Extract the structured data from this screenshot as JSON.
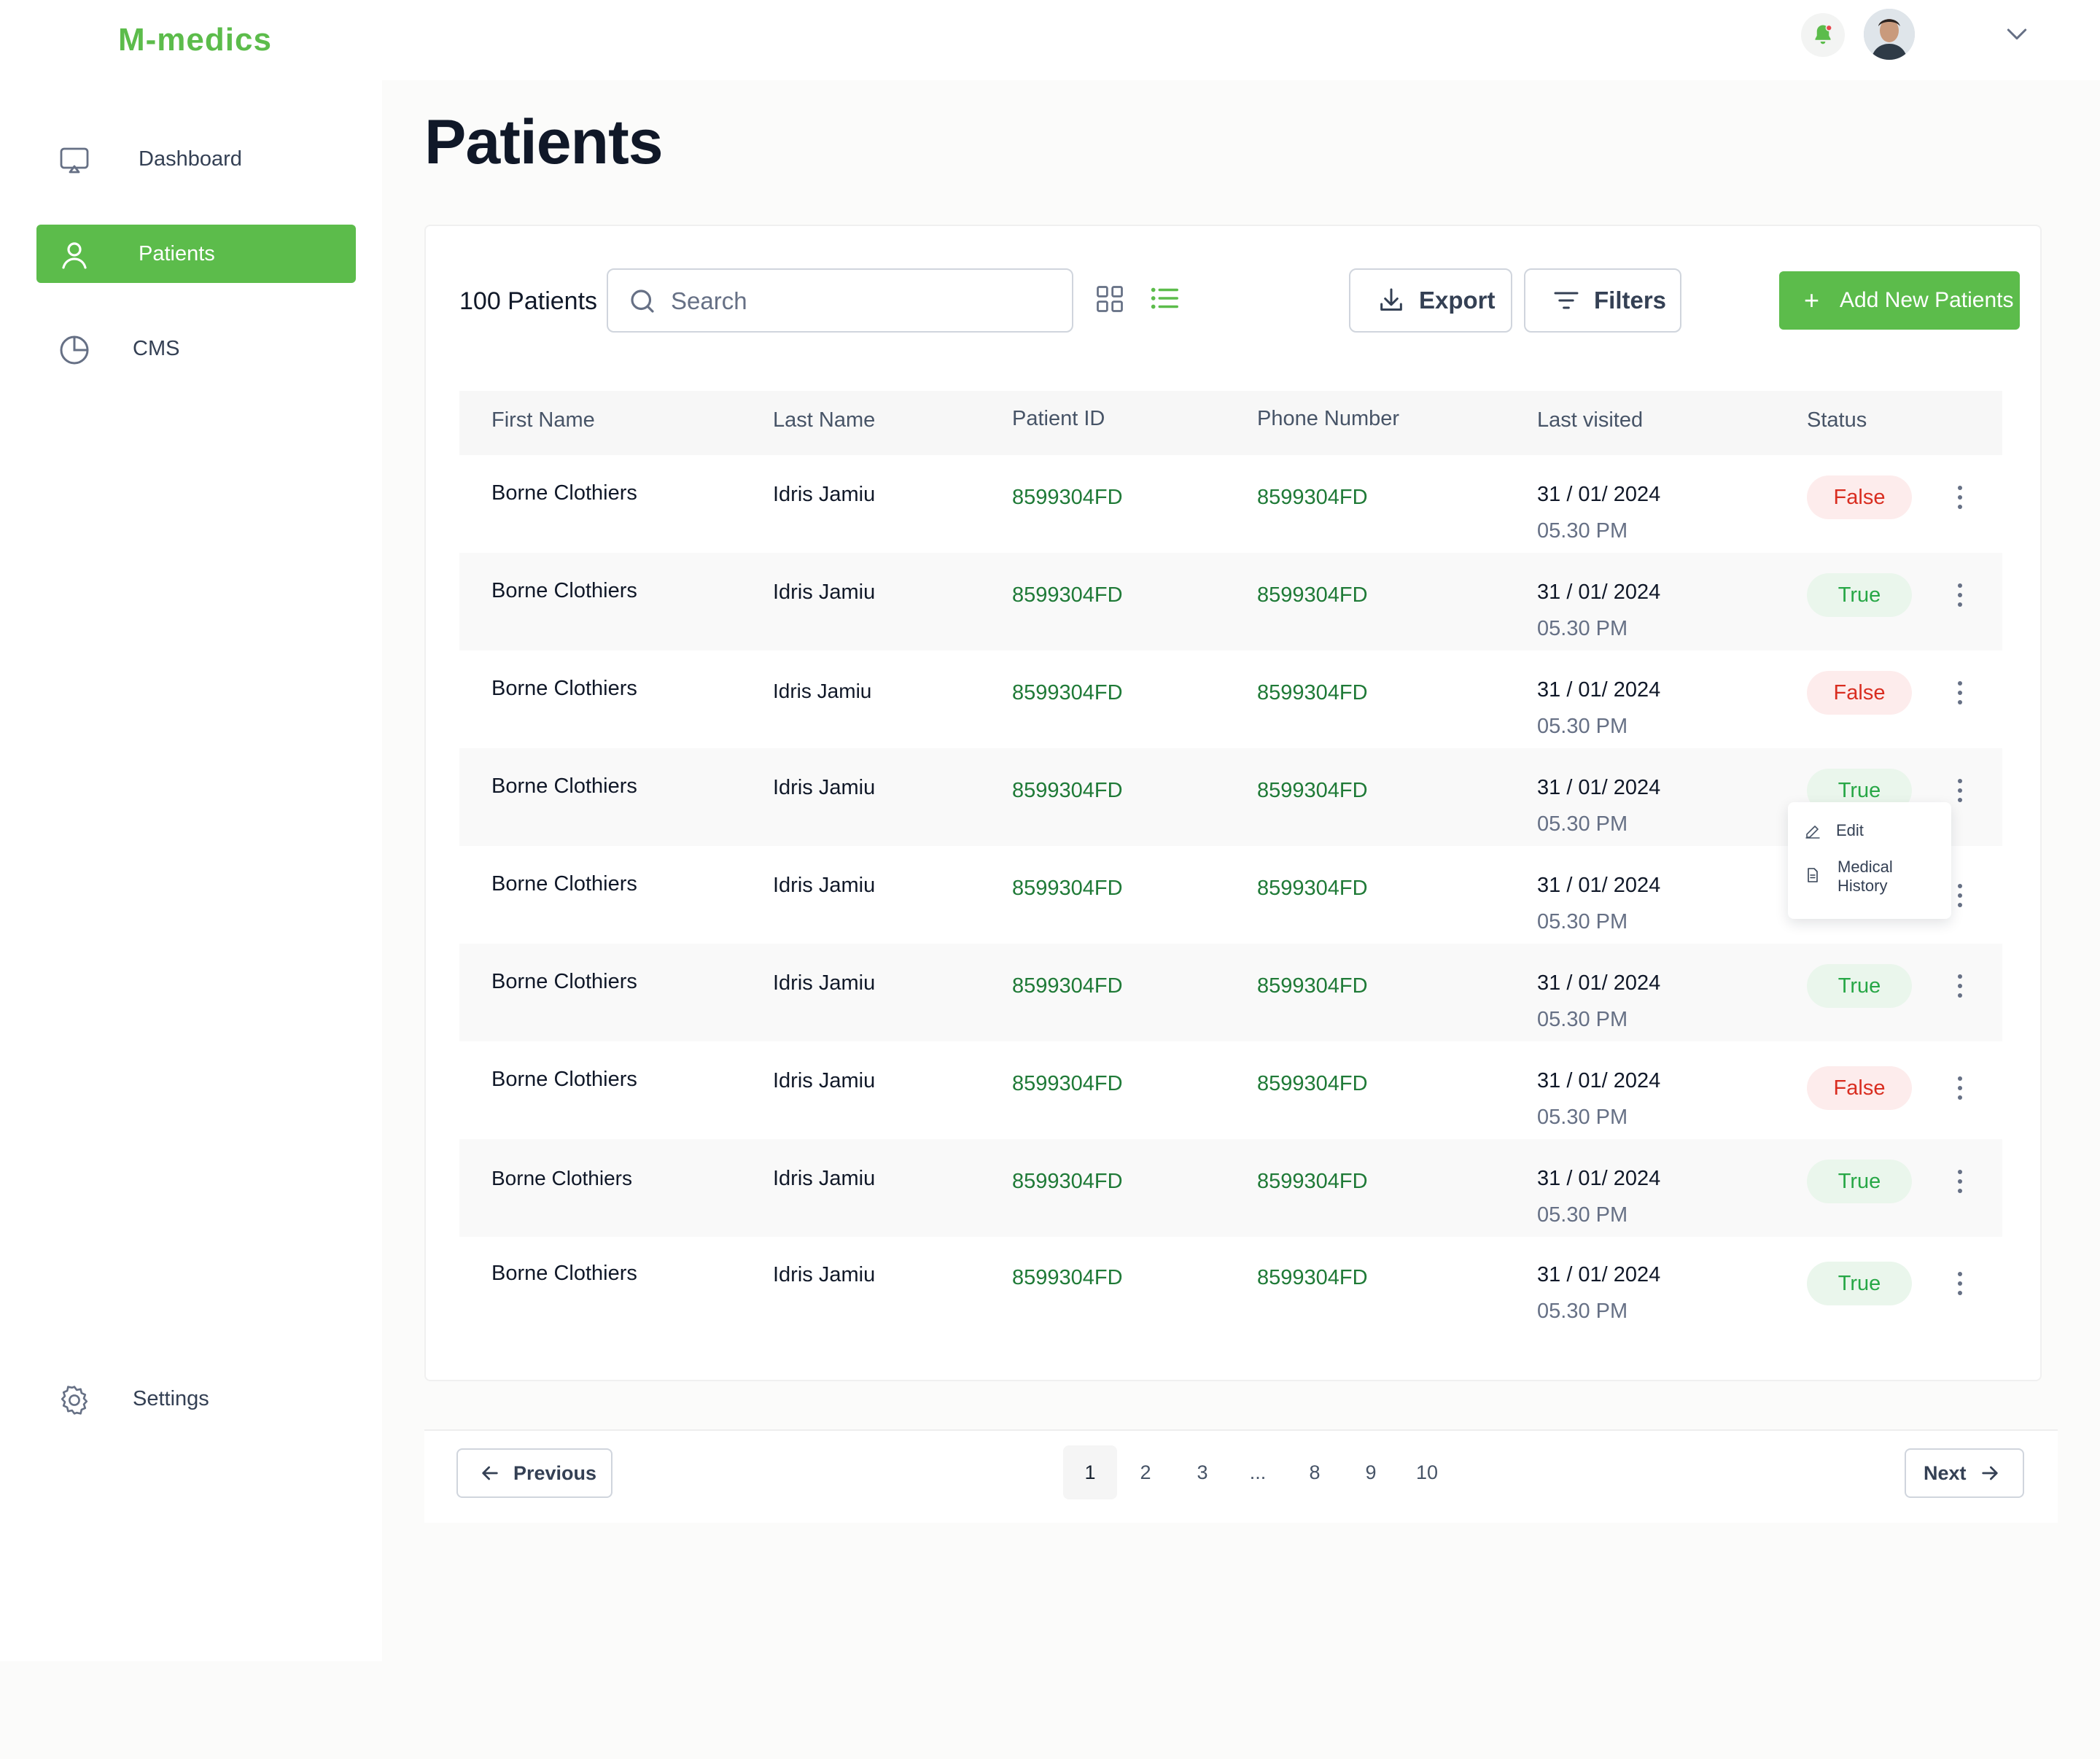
{
  "app": {
    "logo": "M-medics"
  },
  "header": {
    "bell_icon": "bell-icon",
    "has_notification": true,
    "avatar": "user-avatar"
  },
  "sidebar": {
    "items": [
      {
        "label": "Dashboard",
        "icon": "monitor-icon",
        "active": false
      },
      {
        "label": "Patients",
        "icon": "user-icon",
        "active": true
      },
      {
        "label": "CMS",
        "icon": "pie-chart-icon",
        "active": false
      }
    ],
    "settings": {
      "label": "Settings",
      "icon": "gear-icon"
    }
  },
  "page": {
    "title": "Patients"
  },
  "toolbar": {
    "count": "100 Patients",
    "search_placeholder": "Search",
    "export_label": "Export",
    "filters_label": "Filters",
    "add_label": "Add New Patients"
  },
  "table": {
    "columns": [
      "First Name",
      "Last Name",
      "Patient ID",
      "Phone Number",
      "Last visited",
      "Status"
    ],
    "rows": [
      {
        "first": "Borne Clothiers",
        "last": "Idris Jamiu",
        "pid": "8599304FD",
        "phone": "8599304FD",
        "date": "31 / 01/ 2024",
        "time": "05.30 PM",
        "status": "False"
      },
      {
        "first": "Borne Clothiers",
        "last": "Idris Jamiu",
        "pid": "8599304FD",
        "phone": "8599304FD",
        "date": "31 / 01/ 2024",
        "time": "05.30 PM",
        "status": "True"
      },
      {
        "first": "Borne Clothiers",
        "last": "Idris Jamiu",
        "pid": "8599304FD",
        "phone": "8599304FD",
        "date": "31 / 01/ 2024",
        "time": "05.30 PM",
        "status": "False"
      },
      {
        "first": "Borne Clothiers",
        "last": "Idris Jamiu",
        "pid": "8599304FD",
        "phone": "8599304FD",
        "date": "31 / 01/ 2024",
        "time": "05.30 PM",
        "status": "True"
      },
      {
        "first": "Borne Clothiers",
        "last": "Idris Jamiu",
        "pid": "8599304FD",
        "phone": "8599304FD",
        "date": "31 / 01/ 2024",
        "time": "05.30 PM",
        "status": ""
      },
      {
        "first": "Borne Clothiers",
        "last": "Idris Jamiu",
        "pid": "8599304FD",
        "phone": "8599304FD",
        "date": "31 / 01/ 2024",
        "time": "05.30 PM",
        "status": "True"
      },
      {
        "first": "Borne Clothiers",
        "last": "Idris Jamiu",
        "pid": "8599304FD",
        "phone": "8599304FD",
        "date": "31 / 01/ 2024",
        "time": "05.30 PM",
        "status": "False"
      },
      {
        "first": "Borne Clothiers",
        "last": "Idris Jamiu",
        "pid": "8599304FD",
        "phone": "8599304FD",
        "date": "31 / 01/ 2024",
        "time": "05.30 PM",
        "status": "True"
      },
      {
        "first": "Borne Clothiers",
        "last": "Idris Jamiu",
        "pid": "8599304FD",
        "phone": "8599304FD",
        "date": "31 / 01/ 2024",
        "time": "05.30 PM",
        "status": "True"
      }
    ]
  },
  "context_menu": {
    "items": [
      {
        "label": "Edit",
        "icon": "pencil-icon"
      },
      {
        "label": "Medical\nHistory",
        "icon": "document-icon"
      }
    ]
  },
  "pagination": {
    "previous_label": "Previous",
    "next_label": "Next",
    "pages": [
      "1",
      "2",
      "3",
      "...",
      "8",
      "9",
      "10"
    ],
    "current": "1"
  }
}
